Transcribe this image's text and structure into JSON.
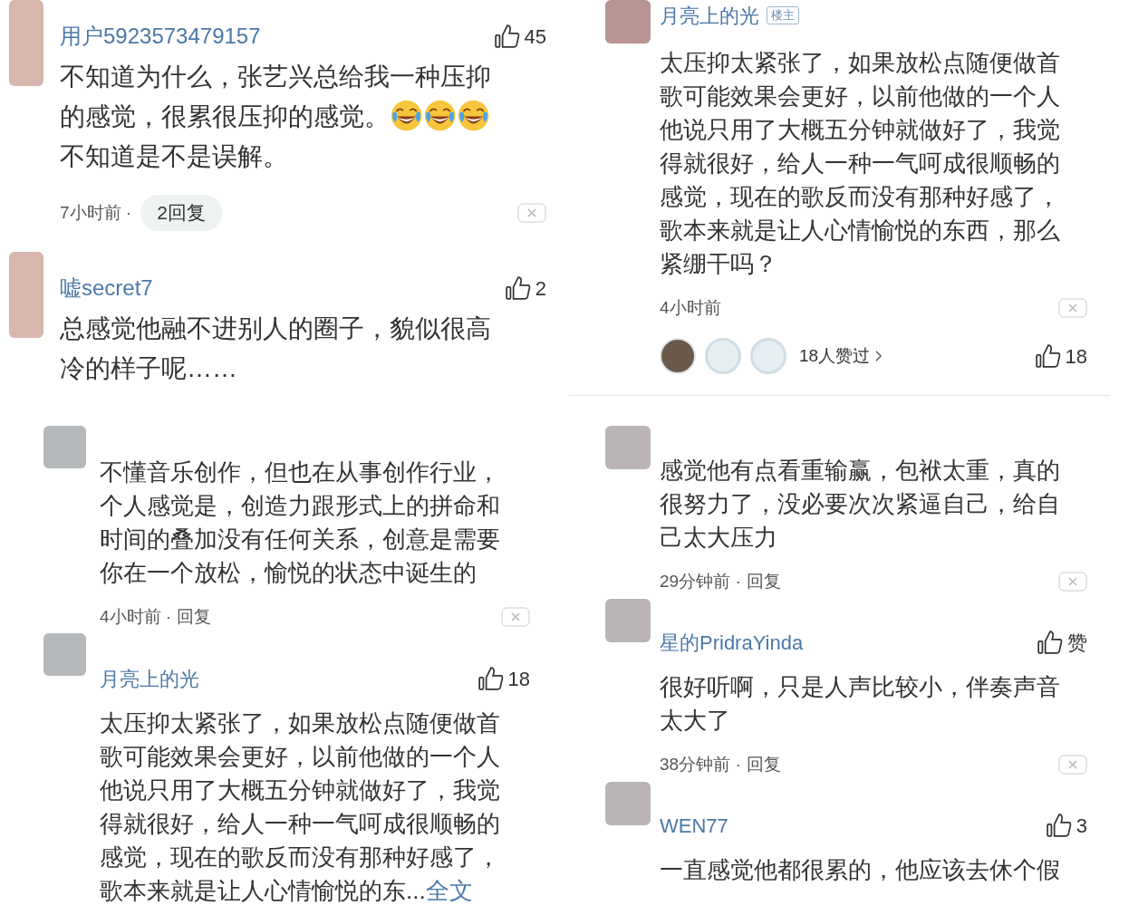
{
  "panels": [
    {
      "comments": [
        {
          "name": "用户5923573479157",
          "likes": "45",
          "body": [
            {
              "kind": "text",
              "text": "不知道为什么，张艺兴总给我一种压抑的感觉，很累很压抑的感觉。"
            },
            {
              "kind": "emoji"
            },
            {
              "kind": "emoji"
            },
            {
              "kind": "emoji"
            },
            {
              "kind": "text",
              "text": "不知道是不是误解。"
            }
          ],
          "time": "7小时前 ·",
          "reply": {
            "kind": "pill",
            "text": "2回复"
          }
        },
        {
          "name": "嘘secret7",
          "likes": "2",
          "body": [
            {
              "kind": "text",
              "text": "总感觉他融不进别人的圈子，貌似很高冷的样子呢……"
            }
          ]
        }
      ]
    },
    {
      "comments": [
        {
          "name": "月亮上的光",
          "badge": "楼主",
          "body": [
            {
              "kind": "text",
              "text": "太压抑太紧张了，如果放松点随便做首歌可能效果会更好，以前他做的一个人他说只用了大概五分钟就做好了，我觉得就很好，给人一种一气呵成很顺畅的感觉，现在的歌反而没有那种好感了，歌本来就是让人心情愉悦的东西，那么紧绷干吗？"
            }
          ],
          "time": "4小时前",
          "liked_by": {
            "text": "18人赞过"
          },
          "likes": "18"
        }
      ]
    },
    {
      "comments": [
        {
          "body": [
            {
              "kind": "text",
              "text": "不懂音乐创作，但也在从事创作行业，个人感觉是，创造力跟形式上的拼命和时间的叠加没有任何关系，创意是需要你在一个放松，愉悦的状态中诞生的"
            }
          ],
          "time": "4小时前 ·",
          "reply": {
            "kind": "link",
            "text": "回复"
          }
        },
        {
          "name": "月亮上的光",
          "likes": "18",
          "body": [
            {
              "kind": "text",
              "text": "太压抑太紧张了，如果放松点随便做首歌可能效果会更好，以前他做的一个人他说只用了大概五分钟就做好了，我觉得就很好，给人一种一气呵成很顺畅的感觉，现在的歌反而没有那种好感了，歌本来就是让人心情愉悦的东..."
            },
            {
              "kind": "link",
              "text": "全文"
            }
          ]
        }
      ]
    },
    {
      "comments": [
        {
          "body": [
            {
              "kind": "text",
              "text": "感觉他有点看重输赢，包袱太重，真的很努力了，没必要次次紧逼自己，给自己太大压力"
            }
          ],
          "time": "29分钟前 ·",
          "reply": {
            "kind": "link",
            "text": "回复"
          }
        },
        {
          "name": "星的PridraYinda",
          "likes": "赞",
          "body": [
            {
              "kind": "text",
              "text": "很好听啊，只是人声比较小，伴奏声音太大了"
            }
          ],
          "time": "38分钟前 ·",
          "reply": {
            "kind": "link",
            "text": "回复"
          }
        },
        {
          "name": "WEN77",
          "likes": "3",
          "body": [
            {
              "kind": "text",
              "text": "一直感觉他都很累的，他应该去休个假"
            }
          ]
        }
      ]
    }
  ]
}
